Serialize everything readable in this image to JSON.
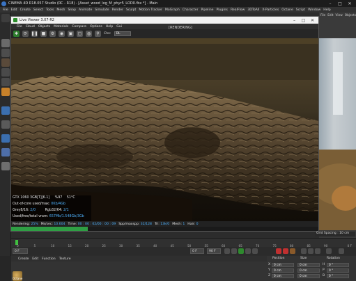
{
  "app": {
    "title": "CINEMA 4D R18.057 Studio (RC - R18) - [Asset_wood_log_M_phyr5_LOD0.fbx *] - Main",
    "menu": [
      "File",
      "Edit",
      "Create",
      "Select",
      "Tools",
      "Mesh",
      "Snap",
      "Animate",
      "Simulate",
      "Render",
      "Sculpt",
      "Motion Tracker",
      "MoGraph",
      "Character",
      "Pipeline",
      "Plugins",
      "RealFlow",
      "3DToAll",
      "X-Particles",
      "Octane",
      "Script",
      "Window",
      "Help"
    ]
  },
  "right_panel": {
    "menu": [
      "File",
      "Edit",
      "View",
      "Objects"
    ]
  },
  "live_viewer": {
    "title": "Live Viewer 3.07-R2",
    "menu": [
      "File",
      "Cloud",
      "Objects",
      "Materials",
      "Compare",
      "Options",
      "Help",
      "Gui"
    ],
    "render_label": "[RENDERING]",
    "channel_label": "Chn:",
    "channel_value": "DL",
    "stats": {
      "gpu": "GTX 1060 3GB[T][6.1]",
      "gpu_util": "%97",
      "gpu_temp": "51°C",
      "ooc_label": "Out-of-core used/max:",
      "ooc_value": "0Kb/4Gb",
      "grey_label": "Grey8/16:",
      "grey_value": "2/0",
      "rgb_label": "Rgb32/64:",
      "rgb_value": "2/1",
      "vram_label": "Used/free/total vram:",
      "vram_value": "657Mb/1.548Gb/3Gb"
    },
    "status": {
      "rendering_label": "Rendering:",
      "rendering_value": "25%",
      "ms_label": "Ms/sec:",
      "ms_value": "10.604",
      "time_label": "Time:",
      "time_value": "00 : 00 : 02/00 : 00 : 09",
      "spp_label": "Spp/maxspp:",
      "spp_value": "32/128",
      "tri_label": "Tri:",
      "tri_value": "13k/0",
      "mesh_label": "Mesh:",
      "mesh_value": "1",
      "hair_label": "Hair:",
      "hair_value": "0"
    },
    "progress": 0.25
  },
  "grid_spacing": "Grid Spacing : 10 cm",
  "timeline": {
    "ticks": [
      "0",
      "5",
      "10",
      "15",
      "20",
      "25",
      "30",
      "35",
      "40",
      "45",
      "50",
      "55",
      "60",
      "65",
      "70",
      "75",
      "80",
      "85",
      "90"
    ],
    "end_label": "0 F",
    "start_field": "0 F",
    "cur_field": "0 F",
    "end_field": "90 F",
    "max_field": "90 F"
  },
  "material_panel": {
    "menu": [
      "Create",
      "Edit",
      "Function",
      "Texture"
    ],
    "thumb_label": "Octane"
  },
  "coords_panel": {
    "headers": [
      "Position",
      "Size",
      "Rotation"
    ],
    "rows": [
      {
        "axis": "X",
        "pos": "0 cm",
        "size": "0 cm",
        "rot_axis": "H",
        "rot": "0 °"
      },
      {
        "axis": "Y",
        "pos": "0 cm",
        "size": "0 cm",
        "rot_axis": "P",
        "rot": "0 °"
      },
      {
        "axis": "Z",
        "pos": "0 cm",
        "size": "0 cm",
        "rot_axis": "B",
        "rot": "0 °"
      }
    ]
  },
  "colors": {
    "accent_value": "#4fb3ff",
    "progress": "#2f9e44"
  }
}
